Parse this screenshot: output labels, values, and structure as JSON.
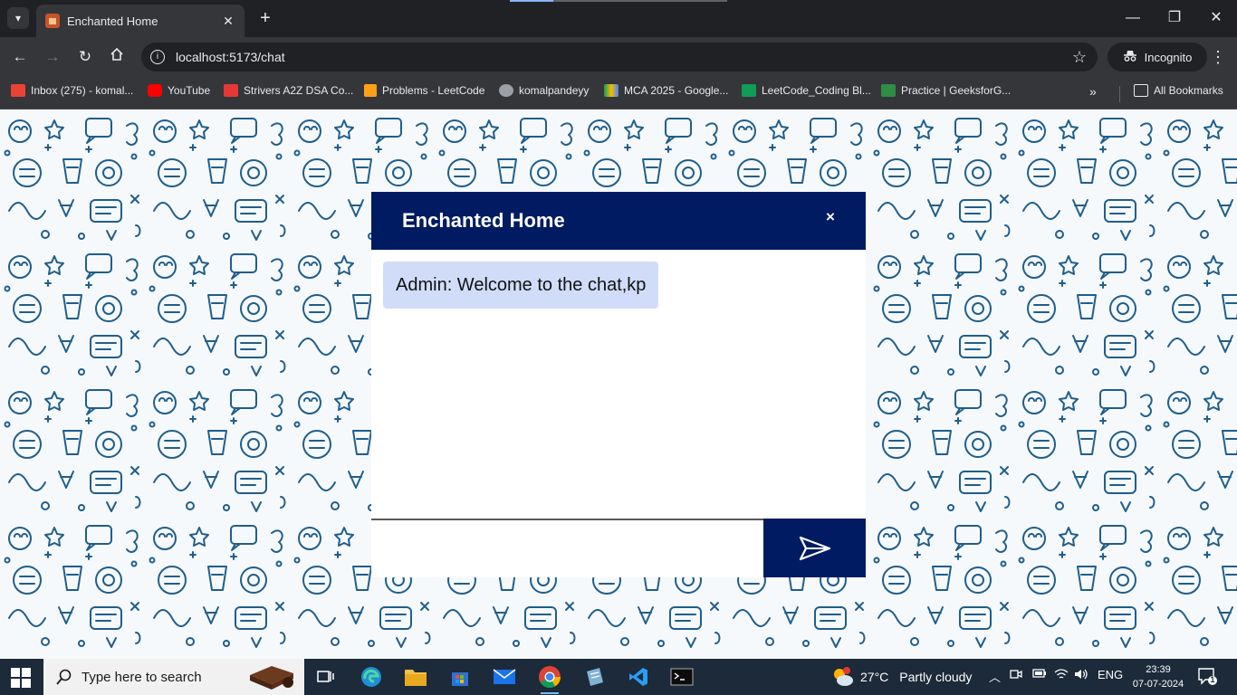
{
  "browser": {
    "tab": {
      "title": "Enchanted Home",
      "close_glyph": "✕"
    },
    "new_tab_glyph": "+",
    "window": {
      "minimize": "—",
      "maximize": "❐",
      "close": "✕"
    },
    "address": {
      "url": "localhost:5173/chat"
    },
    "incognito_label": "Incognito",
    "bookmarks": [
      {
        "label": "Inbox (275) - komal...",
        "icon": "gmail-icon",
        "color": "#ea4335"
      },
      {
        "label": "YouTube",
        "icon": "youtube-icon",
        "color": "#ff0000"
      },
      {
        "label": "Strivers A2Z DSA Co...",
        "icon": "tuf-icon",
        "color": "#e53935"
      },
      {
        "label": "Problems - LeetCode",
        "icon": "leetcode-icon",
        "color": "#ffa116"
      },
      {
        "label": "komalpandeyy",
        "icon": "github-icon",
        "color": "#9aa0a6"
      },
      {
        "label": "MCA 2025 - Google...",
        "icon": "google-drive-icon",
        "color": "#fbbc04"
      },
      {
        "label": "LeetCode_Coding Bl...",
        "icon": "google-sheets-icon",
        "color": "#0f9d58"
      },
      {
        "label": "Practice | GeeksforG...",
        "icon": "geeksforgeeks-icon",
        "color": "#2f8d46"
      }
    ],
    "all_bookmarks_label": "All Bookmarks"
  },
  "chat": {
    "title": "Enchanted Home",
    "close_glyph": "×",
    "messages": [
      {
        "sender": "Admin",
        "text": "Admin: Welcome to the chat,kp"
      }
    ],
    "input": {
      "value": "",
      "placeholder": ""
    },
    "colors": {
      "header": "#001b61",
      "bubble": "#d0dcf8",
      "send": "#001b61"
    }
  },
  "taskbar": {
    "search_placeholder": "Type here to search",
    "weather": {
      "temp": "27°C",
      "condition": "Partly cloudy"
    },
    "language": "ENG",
    "time": "23:39",
    "date": "07-07-2024",
    "notification_count": "1"
  }
}
